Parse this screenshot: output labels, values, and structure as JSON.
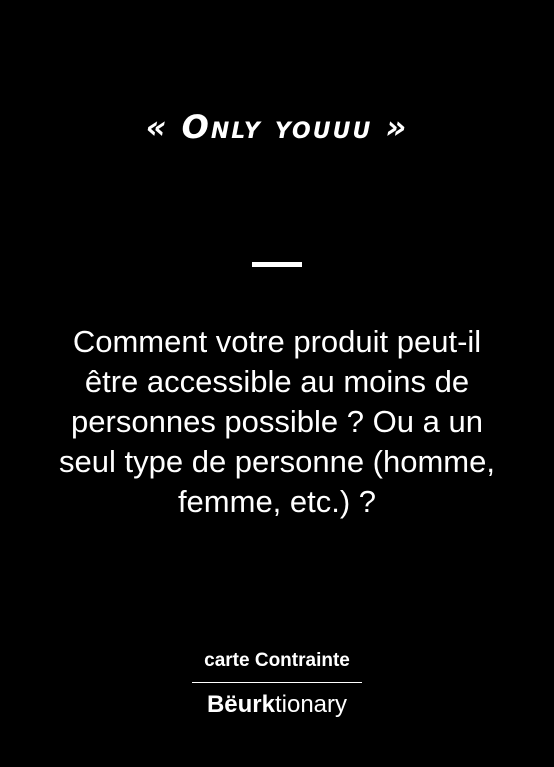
{
  "card": {
    "title": "« Only youuu »",
    "question": "Comment votre produit peut-il être accessible au moins de personnes possible ? Ou a un seul type de personne (homme, femme, etc.) ?",
    "card_type": "carte Contrainte",
    "brand_bold": "Bëurk",
    "brand_light": "tionary",
    "colors": {
      "background": "#000000",
      "text": "#ffffff"
    }
  }
}
